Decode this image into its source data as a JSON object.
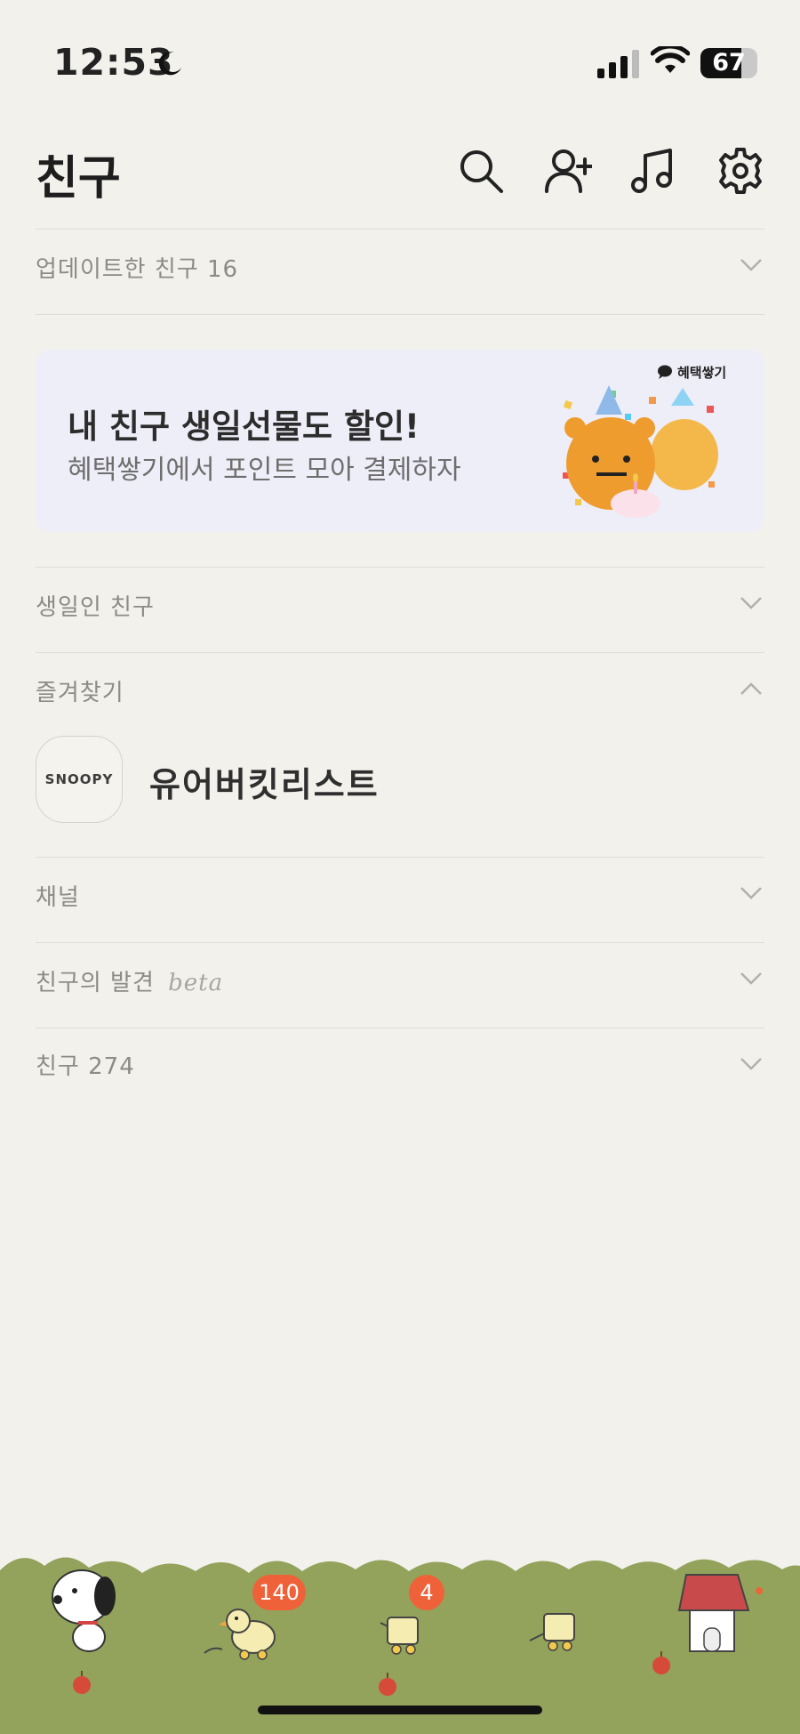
{
  "status_bar": {
    "time": "12:53",
    "battery": "67"
  },
  "header": {
    "title": "친구"
  },
  "rows": {
    "updated": {
      "label": "업데이트한 친구 16"
    },
    "birthday": {
      "label": "생일인 친구"
    },
    "favorites": {
      "label": "즐겨찾기"
    },
    "channel": {
      "label": "채널"
    },
    "discovery": {
      "label": "친구의 발견",
      "beta": "beta"
    },
    "friends": {
      "label": "친구 274"
    }
  },
  "banner": {
    "title": "내 친구 생일선물도 할인!",
    "subtitle": "혜택쌓기에서 포인트 모아 결제하자",
    "tag": "혜택쌓기"
  },
  "favorites": [
    {
      "avatar_text": "SNOOPY",
      "name": "유어버킷리스트"
    }
  ],
  "tabbar": {
    "chats_badge": "140",
    "openchat_badge": "4"
  },
  "colors": {
    "grass": "#93a35c",
    "badge": "#ef6239",
    "background": "#f3f1ec"
  }
}
